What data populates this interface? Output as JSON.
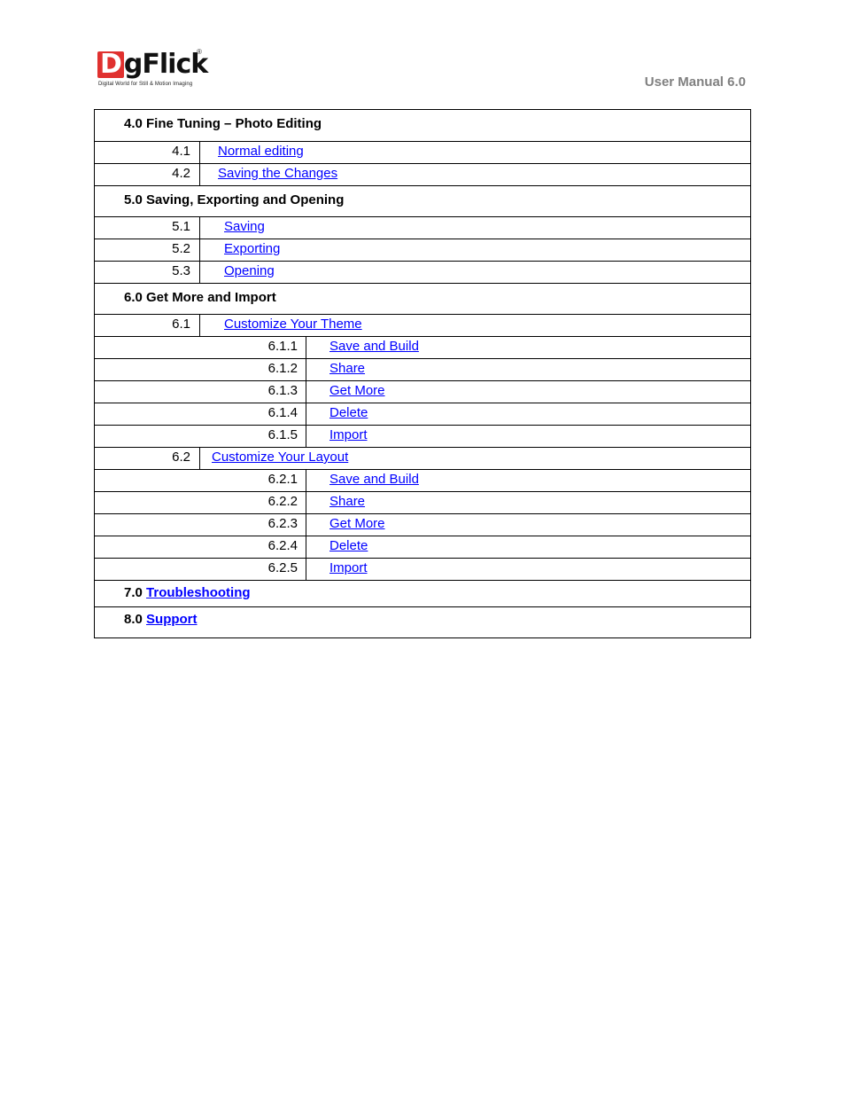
{
  "header": {
    "logo_text_first": "D",
    "logo_text_rest": "gFlick",
    "logo_registered": "®",
    "logo_tagline": "Digital World for Still & Motion Imaging",
    "title": "User Manual 6.0"
  },
  "toc": {
    "s4": {
      "title": "4.0 Fine Tuning – Photo Editing"
    },
    "s4_1": {
      "num": "4.1",
      "label": "Normal editing"
    },
    "s4_2": {
      "num": "4.2",
      "label": "Saving the Changes"
    },
    "s5": {
      "title": "5.0 Saving, Exporting and Opening"
    },
    "s5_1": {
      "num": "5.1",
      "label": "Saving"
    },
    "s5_2": {
      "num": "5.2",
      "label": "Exporting"
    },
    "s5_3": {
      "num": "5.3",
      "label": "Opening"
    },
    "s6": {
      "title": "6.0 Get More and Import"
    },
    "s6_1": {
      "num": "6.1",
      "label": "Customize Your Theme"
    },
    "s6_1_1": {
      "num": "6.1.1",
      "label": "Save and Build"
    },
    "s6_1_2": {
      "num": "6.1.2",
      "label": "Share"
    },
    "s6_1_3": {
      "num": "6.1.3",
      "label": "Get More"
    },
    "s6_1_4": {
      "num": "6.1.4",
      "label": "Delete"
    },
    "s6_1_5": {
      "num": "6.1.5",
      "label": "Import"
    },
    "s6_2": {
      "num": "6.2",
      "label": "Customize Your Layout"
    },
    "s6_2_1": {
      "num": "6.2.1",
      "label": "Save and Build"
    },
    "s6_2_2": {
      "num": "6.2.2",
      "label": "Share"
    },
    "s6_2_3": {
      "num": "6.2.3",
      "label": "Get More"
    },
    "s6_2_4": {
      "num": "6.2.4",
      "label": "Delete"
    },
    "s6_2_5": {
      "num": "6.2.5",
      "label": "Import"
    },
    "s7": {
      "num": "7.0",
      "label": "Troubleshooting"
    },
    "s8": {
      "num": "8.0",
      "label": "Support"
    }
  },
  "colors": {
    "link": "#0000ff",
    "header_gray": "#808080",
    "logo_red": "#e0312f"
  }
}
